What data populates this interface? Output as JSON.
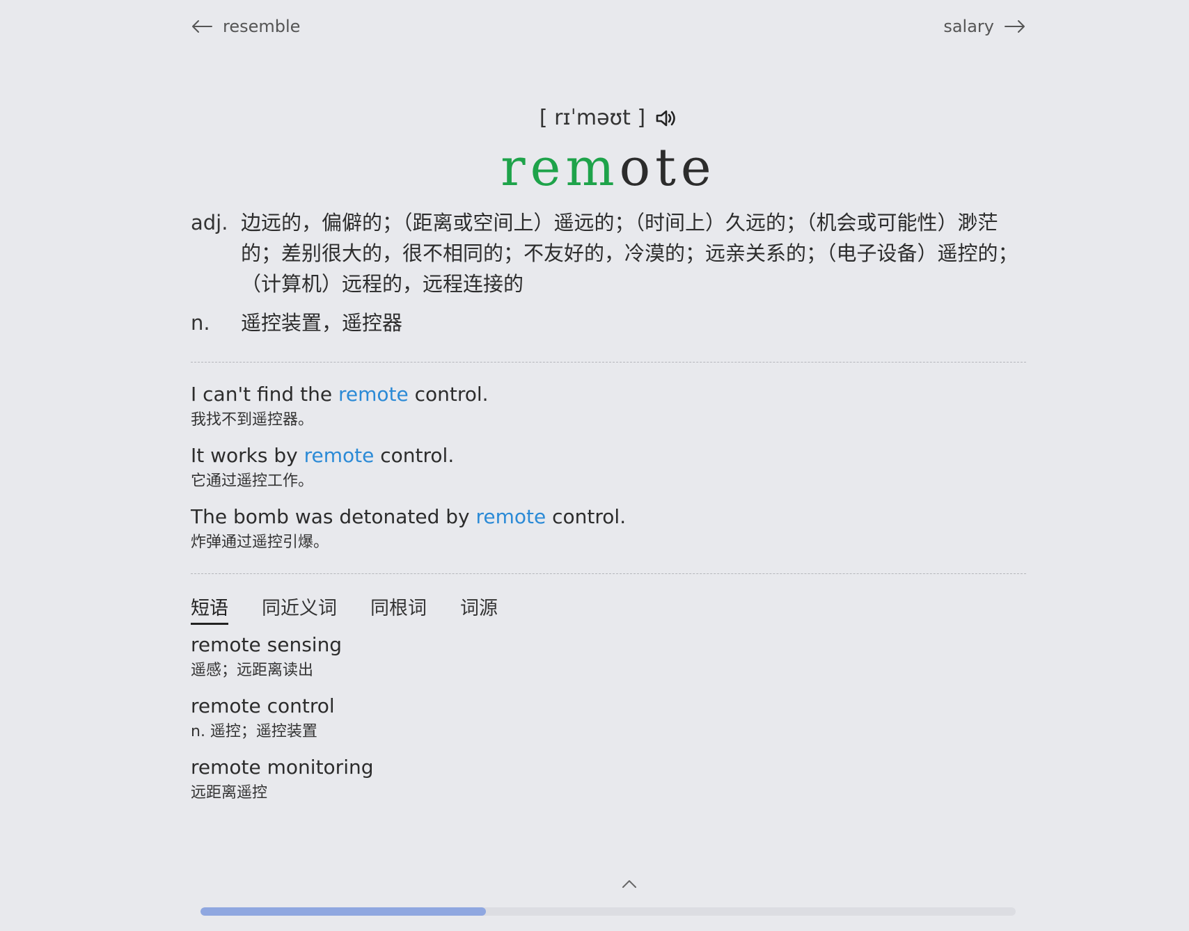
{
  "nav": {
    "prev_word": "resemble",
    "next_word": "salary"
  },
  "entry": {
    "phonetic": "[ rɪˈməʊt ]",
    "headword_highlight": "rem",
    "headword_rest": "ote",
    "highlight_color": "#1ea34a"
  },
  "definitions": [
    {
      "pos": "adj.",
      "meaning": "边远的，偏僻的；（距离或空间上）遥远的；（时间上）久远的；（机会或可能性）渺茫的；差别很大的，很不相同的；不友好的，冷漠的；远亲关系的；（电子设备）遥控的；（计算机）远程的，远程连接的"
    },
    {
      "pos": "n.",
      "meaning": "遥控装置，遥控器"
    }
  ],
  "examples": [
    {
      "before": "I can't find the ",
      "keyword": "remote",
      "after": " control.",
      "zh": "我找不到遥控器。"
    },
    {
      "before": "It works by ",
      "keyword": "remote",
      "after": " control.",
      "zh": "它通过遥控工作。"
    },
    {
      "before": "The bomb was detonated by ",
      "keyword": "remote",
      "after": " control.",
      "zh": "炸弹通过遥控引爆。"
    }
  ],
  "keyword_color": "#2b8ad6",
  "tabs": [
    {
      "label": "短语",
      "active": true
    },
    {
      "label": "同近义词",
      "active": false
    },
    {
      "label": "同根词",
      "active": false
    },
    {
      "label": "词源",
      "active": false
    }
  ],
  "phrases": [
    {
      "en": "remote sensing",
      "zh": "遥感；远距离读出"
    },
    {
      "en": "remote control",
      "zh": "n. 遥控；遥控装置"
    },
    {
      "en": "remote monitoring",
      "zh": "远距离遥控"
    }
  ],
  "progress": {
    "fraction": 0.35,
    "color": "#8fa7e0"
  },
  "icons": {
    "prev": "arrow-left-icon",
    "next": "arrow-right-icon",
    "audio": "speaker-icon",
    "scroll_top": "chevron-up-icon"
  }
}
